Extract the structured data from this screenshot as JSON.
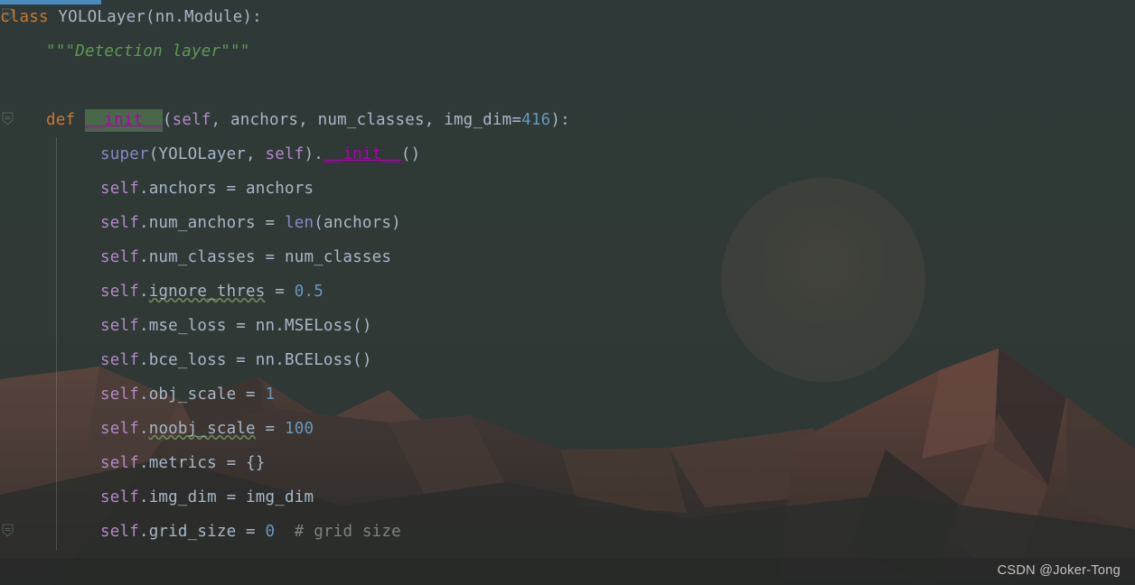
{
  "editor": {
    "language": "python",
    "theme_name": "darcula",
    "background_accent": "#4a8bbf",
    "highlight_color": "#486849",
    "colors": {
      "keyword": "#cc7832",
      "default_text": "#a9b7c6",
      "docstring": "#629755",
      "self_keyword": "#b389c5",
      "number": "#6897bb",
      "builtin_function": "#8888c6",
      "comment": "#808080",
      "magic_method": "#b200b2",
      "editor_background": "#303b39"
    },
    "gutter": {
      "fold_markers": [
        "collapse-marker",
        "collapse-marker",
        "collapse-marker"
      ]
    },
    "lines": [
      {
        "n": 1,
        "indent": 0,
        "tokens": [
          {
            "t": "class ",
            "c": "kw"
          },
          {
            "t": "YOLOLayer(nn.Module):",
            "c": "plain"
          }
        ]
      },
      {
        "n": 2,
        "indent": 1,
        "tokens": [
          {
            "t": "\"\"\"Detection layer\"\"\"",
            "c": "doc"
          }
        ]
      },
      {
        "n": 3,
        "indent": 0,
        "tokens": []
      },
      {
        "n": 4,
        "indent": 1,
        "tokens": [
          {
            "t": "def ",
            "c": "kw"
          },
          {
            "t": "__init__",
            "c": "magic hl"
          },
          {
            "t": "(",
            "c": "plain"
          },
          {
            "t": "self",
            "c": "self"
          },
          {
            "t": ", anchors, num_classes, img_dim=",
            "c": "plain"
          },
          {
            "t": "416",
            "c": "num"
          },
          {
            "t": "):",
            "c": "plain"
          }
        ]
      },
      {
        "n": 5,
        "indent": 2,
        "tokens": [
          {
            "t": "super",
            "c": "builtin"
          },
          {
            "t": "(YOLOLayer, ",
            "c": "plain"
          },
          {
            "t": "self",
            "c": "self"
          },
          {
            "t": ").",
            "c": "plain"
          },
          {
            "t": "__init__",
            "c": "magic"
          },
          {
            "t": "()",
            "c": "plain"
          }
        ]
      },
      {
        "n": 6,
        "indent": 2,
        "tokens": [
          {
            "t": "self",
            "c": "self"
          },
          {
            "t": ".anchors = anchors",
            "c": "plain"
          }
        ]
      },
      {
        "n": 7,
        "indent": 2,
        "tokens": [
          {
            "t": "self",
            "c": "self"
          },
          {
            "t": ".num_anchors = ",
            "c": "plain"
          },
          {
            "t": "len",
            "c": "builtin"
          },
          {
            "t": "(anchors)",
            "c": "plain"
          }
        ]
      },
      {
        "n": 8,
        "indent": 2,
        "tokens": [
          {
            "t": "self",
            "c": "self"
          },
          {
            "t": ".num_classes = num_classes",
            "c": "plain"
          }
        ]
      },
      {
        "n": 9,
        "indent": 2,
        "tokens": [
          {
            "t": "self",
            "c": "self"
          },
          {
            "t": ".",
            "c": "plain"
          },
          {
            "t": "ignore_thres",
            "c": "plain sq"
          },
          {
            "t": " = ",
            "c": "plain"
          },
          {
            "t": "0.5",
            "c": "num"
          }
        ]
      },
      {
        "n": 10,
        "indent": 2,
        "tokens": [
          {
            "t": "self",
            "c": "self"
          },
          {
            "t": ".mse_loss = nn.MSELoss()",
            "c": "plain"
          }
        ]
      },
      {
        "n": 11,
        "indent": 2,
        "tokens": [
          {
            "t": "self",
            "c": "self"
          },
          {
            "t": ".bce_loss = nn.BCELoss()",
            "c": "plain"
          }
        ]
      },
      {
        "n": 12,
        "indent": 2,
        "tokens": [
          {
            "t": "self",
            "c": "self"
          },
          {
            "t": ".obj_scale = ",
            "c": "plain"
          },
          {
            "t": "1",
            "c": "num"
          }
        ]
      },
      {
        "n": 13,
        "indent": 2,
        "tokens": [
          {
            "t": "self",
            "c": "self"
          },
          {
            "t": ".",
            "c": "plain"
          },
          {
            "t": "noobj_scale",
            "c": "plain sq"
          },
          {
            "t": " = ",
            "c": "plain"
          },
          {
            "t": "100",
            "c": "num"
          }
        ]
      },
      {
        "n": 14,
        "indent": 2,
        "tokens": [
          {
            "t": "self",
            "c": "self"
          },
          {
            "t": ".metrics = {}",
            "c": "plain"
          }
        ]
      },
      {
        "n": 15,
        "indent": 2,
        "tokens": [
          {
            "t": "self",
            "c": "self"
          },
          {
            "t": ".img_dim = img_dim",
            "c": "plain"
          }
        ]
      },
      {
        "n": 16,
        "indent": 2,
        "tokens": [
          {
            "t": "self",
            "c": "self"
          },
          {
            "t": ".grid_size = ",
            "c": "plain"
          },
          {
            "t": "0",
            "c": "num"
          },
          {
            "t": "  ",
            "c": "plain"
          },
          {
            "t": "# grid size",
            "c": "comment"
          }
        ]
      }
    ]
  },
  "watermark": {
    "text": "CSDN @Joker-Tong"
  }
}
